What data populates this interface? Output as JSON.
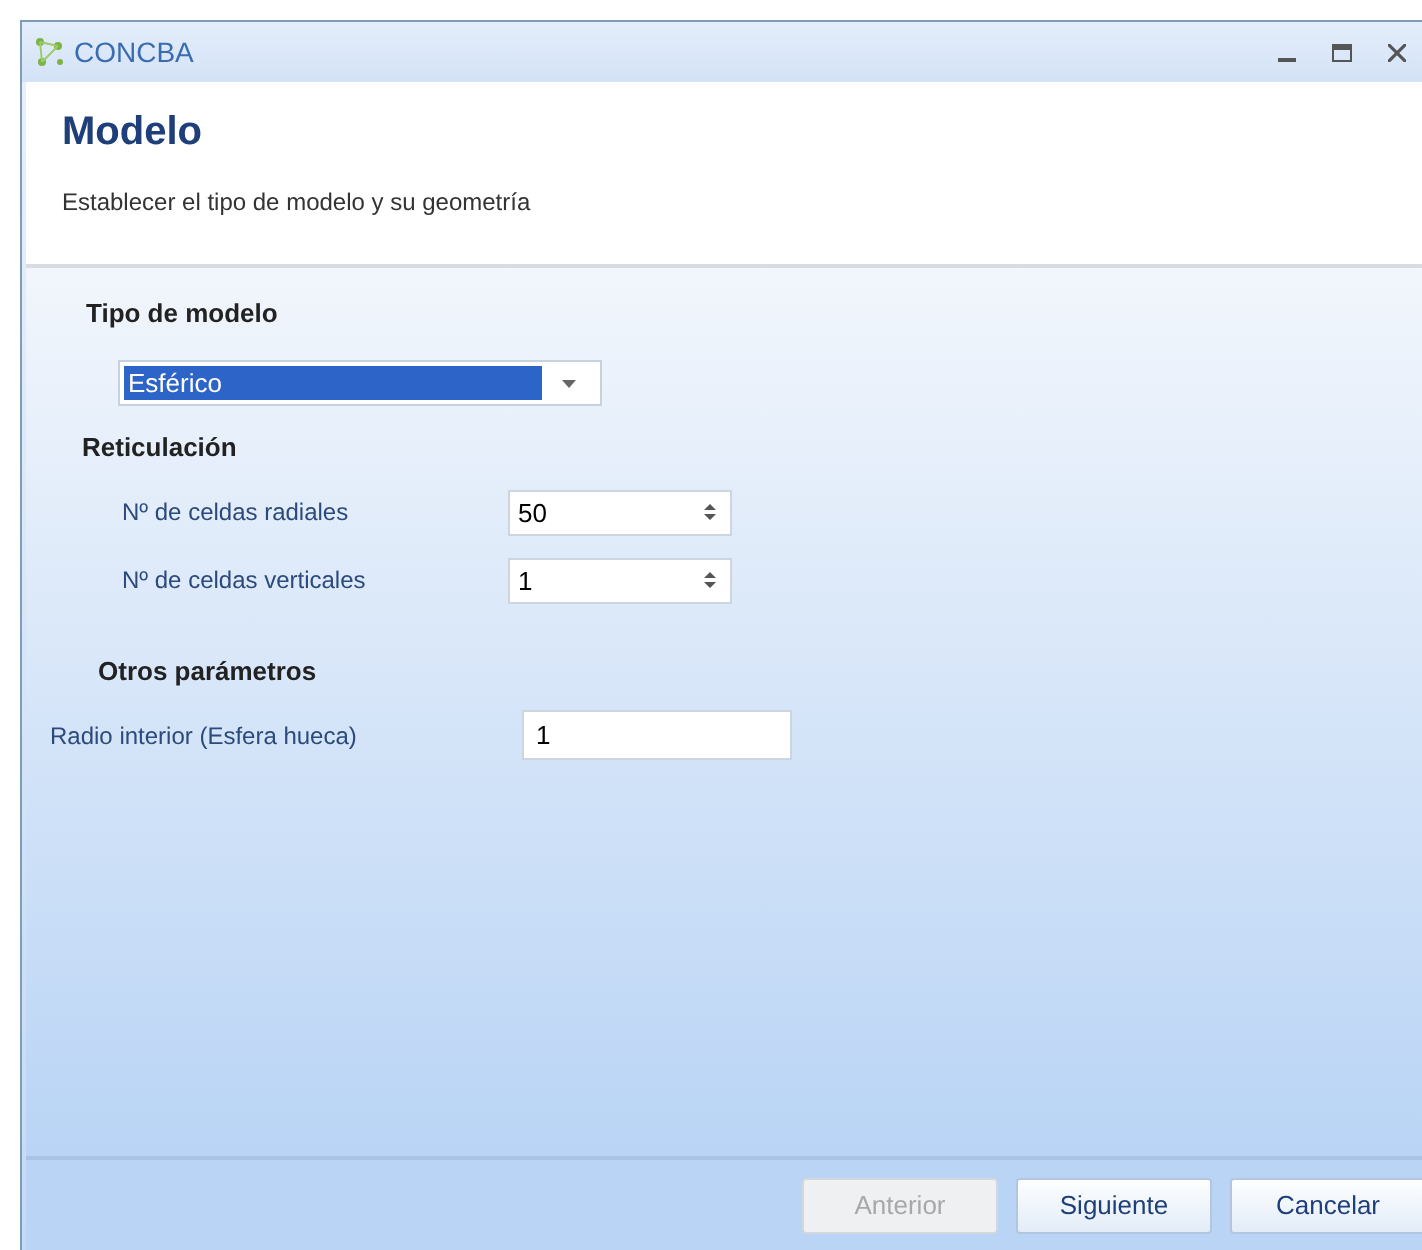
{
  "window": {
    "title": "CONCBA"
  },
  "header": {
    "title": "Modelo",
    "subtitle": "Establecer el tipo de modelo y su geometría"
  },
  "model_type": {
    "label": "Tipo de modelo",
    "value": "Esférico",
    "highlighted": true
  },
  "mesh": {
    "label": "Reticulación",
    "fields": [
      {
        "label": "Nº de celdas radiales",
        "value": "50"
      },
      {
        "label": "Nº de celdas verticales",
        "value": "1"
      }
    ]
  },
  "other": {
    "label": "Otros parámetros",
    "fields": [
      {
        "label": "Radio interior (Esfera hueca)",
        "value": "1"
      }
    ]
  },
  "buttons": [
    {
      "label": "Anterior",
      "disabled": true
    },
    {
      "label": "Siguiente",
      "disabled": false
    },
    {
      "label": "Cancelar",
      "disabled": false
    }
  ]
}
